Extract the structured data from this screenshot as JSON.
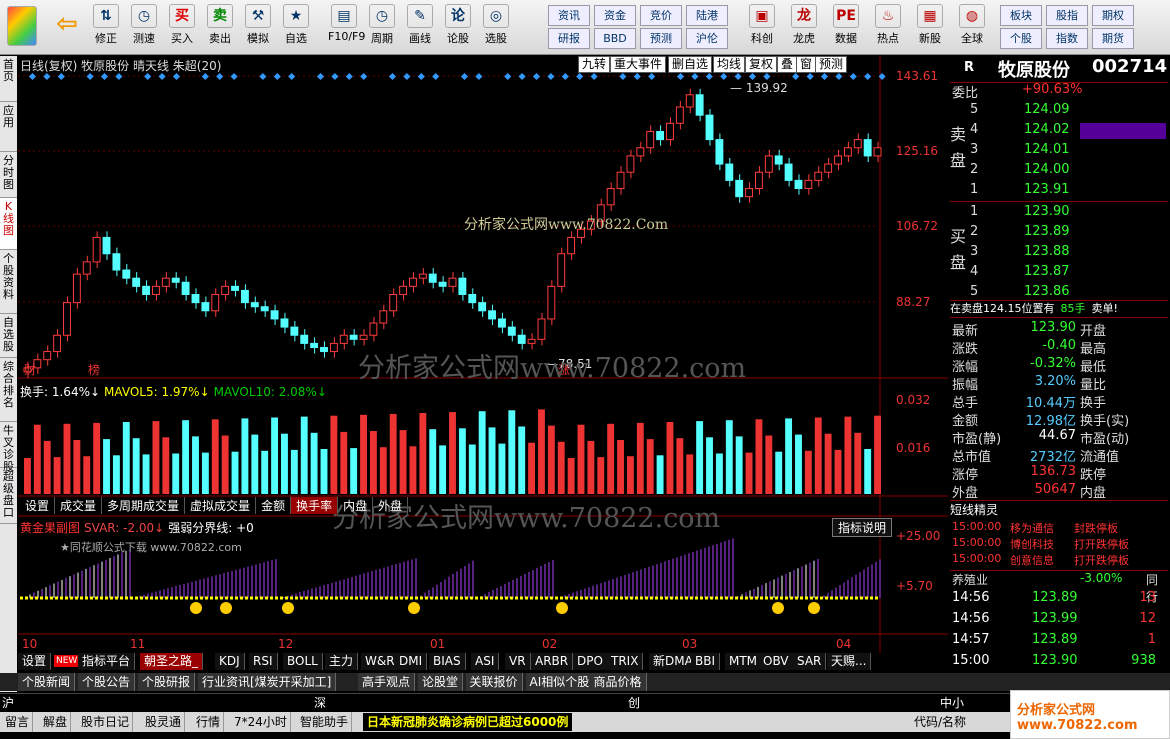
{
  "toolbar": {
    "left": [
      {
        "label": "修正",
        "icon": "⇅"
      },
      {
        "label": "测速",
        "icon": "◷"
      },
      {
        "label": "买入",
        "icon": "买"
      },
      {
        "label": "卖出",
        "icon": "卖"
      },
      {
        "label": "模拟",
        "icon": "⚒"
      },
      {
        "label": "自选",
        "icon": "★"
      },
      {
        "label": "F10/F9",
        "icon": "▤"
      },
      {
        "label": "周期",
        "icon": "◷"
      },
      {
        "label": "画线",
        "icon": "✎"
      },
      {
        "label": "论股",
        "icon": "论"
      },
      {
        "label": "选股",
        "icon": "◎"
      }
    ],
    "small": [
      [
        "资讯",
        "资金",
        "竞价",
        "陆港"
      ],
      [
        "研报",
        "BBD",
        "预测",
        "沪伦"
      ]
    ],
    "right": [
      {
        "label": "科创",
        "icon": "▣"
      },
      {
        "label": "龙虎",
        "icon": "龙"
      },
      {
        "label": "数据",
        "icon": "PE"
      },
      {
        "label": "热点",
        "icon": "♨"
      },
      {
        "label": "新股",
        "icon": "▦"
      },
      {
        "label": "全球",
        "icon": "◍"
      }
    ],
    "small2": [
      [
        "板块",
        "股指",
        "期权"
      ],
      [
        "个股",
        "指数",
        "期货"
      ]
    ]
  },
  "sidebar": [
    "首页",
    "应用",
    "分时图",
    "K线图",
    "个股资料",
    "自选股",
    "综合排名",
    "牛叉诊股",
    "超级盘口"
  ],
  "chart": {
    "header": "日线(复权) 牧原股份 晴天线 朱超(20)",
    "header_tabs": [
      "九转",
      "重大事件",
      "删自选",
      "均线",
      "复权",
      "叠",
      "窗",
      "预测"
    ],
    "price_labels": [
      "143.61",
      "125.16",
      "106.72",
      "88.27"
    ],
    "high_label": "139.92",
    "low_label": "78.51",
    "markers": [
      "财",
      "榜",
      "涨"
    ],
    "watermark": "分析家公式网www.70822.com",
    "watermark_small": "分析家公式网www.70822.Com",
    "vol_header": [
      "换手: 1.64%↓",
      "MAVOL5: 1.97%↓",
      "MAVOL10: 2.08%↓"
    ],
    "vol_labels": [
      "0.032",
      "0.016"
    ],
    "sub_tabs": [
      "设置",
      "成交量",
      "多周期成交量",
      "虚拟成交量",
      "金额",
      "换手率",
      "内盘",
      "外盘"
    ],
    "ind_header": [
      "黄金果副图",
      "SVAR: -2.00↓",
      "强弱分界线: +0"
    ],
    "ind_button": "指标说明",
    "ind_note": "★同花顺公式下载 www.70822.com",
    "ind_labels": [
      "+25.00",
      "+5.70"
    ],
    "x_labels": [
      "10",
      "11",
      "12",
      "01",
      "02",
      "03",
      "04"
    ]
  },
  "bottom_tabs": [
    "设置",
    "指标平台",
    "朝圣之路_",
    "KDJ",
    "RSI",
    "BOLL",
    "主力",
    "W&R",
    "DMI",
    "BIAS",
    "ASI",
    "VR",
    "ARBR",
    "DPO",
    "TRIX",
    "新DMA",
    "BBI",
    "MTM",
    "OBV",
    "SAR",
    "天赐..."
  ],
  "bottom_new": "NEW",
  "news_tabs": [
    "个股新闻",
    "个股公告",
    "个股研报",
    "行业资讯[煤炭开采加工]",
    "高手观点",
    "论股堂",
    "关联报价",
    "AI相似个股",
    "商品价格"
  ],
  "index_row": [
    "沪",
    "深",
    "创",
    "中小"
  ],
  "status_bar": [
    "留言",
    "解盘",
    "股市日记",
    "股灵通",
    "行情",
    "7*24小时",
    "智能助手"
  ],
  "ticker": "日本新冠肺炎确诊病例已超过6000例",
  "status_right": "代码/名称",
  "logo": "分析家公式网 www.70822.com",
  "stock": {
    "tag": "R",
    "name": "牧原股份",
    "code": "002714",
    "wei": {
      "label": "委比",
      "value": "+90.63%"
    },
    "sell_label": "卖盘",
    "buy_label": "买盘",
    "sell": [
      [
        "5",
        "124.09"
      ],
      [
        "4",
        "124.02"
      ],
      [
        "3",
        "124.01"
      ],
      [
        "2",
        "124.00"
      ],
      [
        "1",
        "123.91"
      ]
    ],
    "buy": [
      [
        "1",
        "123.90"
      ],
      [
        "2",
        "123.89"
      ],
      [
        "3",
        "123.88"
      ],
      [
        "4",
        "123.87"
      ],
      [
        "5",
        "123.86"
      ]
    ],
    "notice": [
      "在卖盘124.15位置有",
      "85手",
      "卖单!"
    ],
    "stats": [
      [
        "最新",
        "123.90",
        "开盘"
      ],
      [
        "涨跌",
        "-0.40",
        "最高"
      ],
      [
        "涨幅",
        "-0.32%",
        "最低"
      ],
      [
        "振幅",
        "3.20%",
        "量比"
      ],
      [
        "总手",
        "10.44万",
        "换手"
      ],
      [
        "金额",
        "12.98亿",
        "换手(实)"
      ],
      [
        "市盈(静)",
        "44.67",
        "市盈(动)"
      ],
      [
        "总市值",
        "2732亿",
        "流通值"
      ],
      [
        "涨停",
        "136.73",
        "跌停"
      ],
      [
        "外盘",
        "50647",
        "内盘"
      ]
    ],
    "elves_title": "短线精灵",
    "elves": [
      [
        "15:00:00",
        "移为通信",
        "封跌停板"
      ],
      [
        "15:00:00",
        "博创科技",
        "打开跌停板"
      ],
      [
        "15:00:00",
        "创意信息",
        "打开跌停板"
      ]
    ],
    "industry": [
      "养殖业",
      "-3.00%",
      "同行"
    ],
    "ticks": [
      [
        "14:56",
        "123.89",
        "13"
      ],
      [
        "14:56",
        "123.99",
        "12"
      ],
      [
        "14:57",
        "123.89",
        "1"
      ],
      [
        "15:00",
        "123.90",
        "938"
      ]
    ]
  },
  "colors": {
    "up": "#ff3c3c",
    "down": "#54ffff",
    "bg": "#000000",
    "accent": "#ffff00"
  }
}
